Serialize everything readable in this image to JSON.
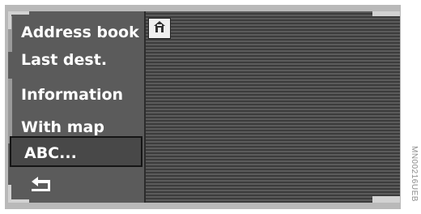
{
  "menu": {
    "items": [
      {
        "label": "Address book"
      },
      {
        "label": "Last dest."
      },
      {
        "label": "Information"
      },
      {
        "label": "With map"
      },
      {
        "label": "ABC..."
      }
    ],
    "selected_label": "ABC...",
    "back_icon": "return-arrow-icon"
  },
  "map": {
    "home_icon": "home-icon"
  },
  "watermark": "MN00216UEB",
  "colors": {
    "screen_bg": "#3a3a3a",
    "menu_bg": "#5b5b5b",
    "text": "#ffffff"
  }
}
